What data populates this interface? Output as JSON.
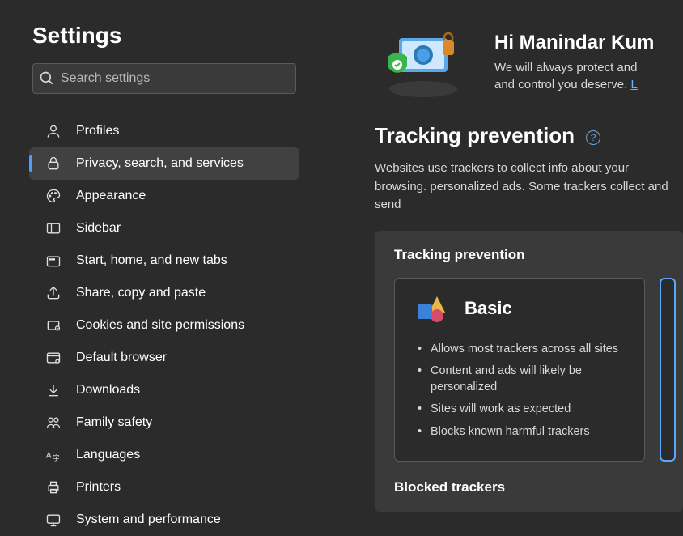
{
  "sidebar": {
    "title": "Settings",
    "search_placeholder": "Search settings",
    "items": [
      {
        "label": "Profiles",
        "icon": "profile-icon"
      },
      {
        "label": "Privacy, search, and services",
        "icon": "lock-icon",
        "active": true
      },
      {
        "label": "Appearance",
        "icon": "palette-icon"
      },
      {
        "label": "Sidebar",
        "icon": "sidebar-icon"
      },
      {
        "label": "Start, home, and new tabs",
        "icon": "tabs-icon"
      },
      {
        "label": "Share, copy and paste",
        "icon": "share-icon"
      },
      {
        "label": "Cookies and site permissions",
        "icon": "cookie-icon"
      },
      {
        "label": "Default browser",
        "icon": "browser-icon"
      },
      {
        "label": "Downloads",
        "icon": "download-icon"
      },
      {
        "label": "Family safety",
        "icon": "family-icon"
      },
      {
        "label": "Languages",
        "icon": "language-icon"
      },
      {
        "label": "Printers",
        "icon": "printer-icon"
      },
      {
        "label": "System and performance",
        "icon": "system-icon"
      }
    ]
  },
  "greeting": {
    "title": "Hi Manindar Kum",
    "line1": "We will always protect and",
    "line2": "and control you deserve.",
    "link": "L"
  },
  "tracking": {
    "heading": "Tracking prevention",
    "description": "Websites use trackers to collect info about your browsing. personalized ads. Some trackers collect and send",
    "card_title": "Tracking prevention",
    "levels": {
      "basic": {
        "name": "Basic",
        "points": [
          "Allows most trackers across all sites",
          "Content and ads will likely be personalized",
          "Sites will work as expected",
          "Blocks known harmful trackers"
        ]
      }
    },
    "blocked_heading": "Blocked trackers"
  }
}
